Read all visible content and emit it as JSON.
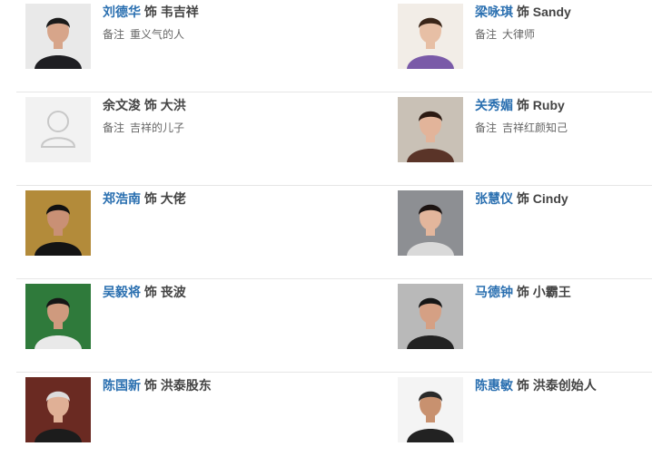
{
  "role_connector": "饰",
  "note_label": "备注",
  "cast": [
    {
      "actor": "刘德华",
      "role": "韦吉祥",
      "note": "重义气的人",
      "photo": "person-photo",
      "bg": "#e9e9e9",
      "skin": "#d7a58a",
      "cloth": "#1e1e22",
      "hair": "#1a1a1a"
    },
    {
      "actor": "梁咏琪",
      "role": "Sandy",
      "note": "大律师",
      "photo": "person-photo",
      "bg": "#f2ede7",
      "skin": "#e7bfa5",
      "cloth": "#7a5aa8",
      "hair": "#3a2518"
    },
    {
      "actor": "余文浚",
      "role": "大洪",
      "note": "吉祥的儿子",
      "photo": "avatar-placeholder-icon",
      "plain": true
    },
    {
      "actor": "关秀媚",
      "role": "Ruby",
      "note": "吉祥红颜知己",
      "photo": "person-photo",
      "bg": "#c9c1b6",
      "skin": "#e2b49a",
      "cloth": "#5a3428",
      "hair": "#2b1a12"
    },
    {
      "actor": "郑浩南",
      "role": "大佬",
      "note": "",
      "photo": "person-photo",
      "bg": "#b38b3a",
      "skin": "#c99075",
      "cloth": "#141414",
      "hair": "#111111"
    },
    {
      "actor": "张慧仪",
      "role": "Cindy",
      "note": "",
      "photo": "person-photo",
      "bg": "#8d8f93",
      "skin": "#e3b69c",
      "cloth": "#d9d9d9",
      "hair": "#1c1412"
    },
    {
      "actor": "吴毅将",
      "role": "丧波",
      "note": "",
      "photo": "person-photo",
      "bg": "#2f7a3b",
      "skin": "#cf9a7e",
      "cloth": "#e9e9e9",
      "hair": "#161616"
    },
    {
      "actor": "马德钟",
      "role": "小霸王",
      "note": "",
      "photo": "person-photo",
      "bg": "#b9b9b9",
      "skin": "#d5a084",
      "cloth": "#222222",
      "hair": "#161616"
    },
    {
      "actor": "陈国新",
      "role": "洪泰股东",
      "note": "",
      "photo": "person-photo",
      "bg": "#6a2a22",
      "skin": "#e0b096",
      "cloth": "#1c1c1c",
      "hair": "#dcdcdc"
    },
    {
      "actor": "陈惠敏",
      "role": "洪泰创始人",
      "note": "",
      "photo": "person-photo",
      "bg": "#f4f4f4",
      "skin": "#c8916f",
      "cloth": "#222222",
      "hair": "#2a2a2a"
    }
  ]
}
